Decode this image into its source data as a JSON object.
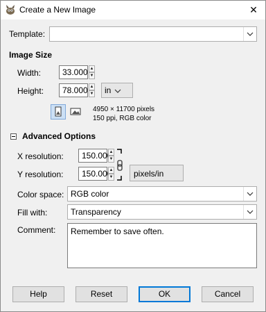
{
  "window": {
    "title": "Create a New Image",
    "close_glyph": "✕"
  },
  "template": {
    "label": "Template:",
    "value": ""
  },
  "image_size": {
    "heading": "Image Size",
    "width_label": "Width:",
    "width_value": "33.000",
    "height_label": "Height:",
    "height_value": "78.000",
    "unit": "in",
    "pixels_info": "4950 × 11700 pixels",
    "res_info": "150 ppi, RGB color"
  },
  "advanced": {
    "heading": "Advanced Options",
    "xres_label": "X resolution:",
    "xres_value": "150.000",
    "yres_label": "Y resolution:",
    "yres_value": "150.000",
    "res_unit": "pixels/in",
    "colorspace_label": "Color space:",
    "colorspace_value": "RGB color",
    "fill_label": "Fill with:",
    "fill_value": "Transparency",
    "comment_label": "Comment:",
    "comment_value": "Remember to save often."
  },
  "buttons": {
    "help": "Help",
    "reset": "Reset",
    "ok": "OK",
    "cancel": "Cancel"
  }
}
